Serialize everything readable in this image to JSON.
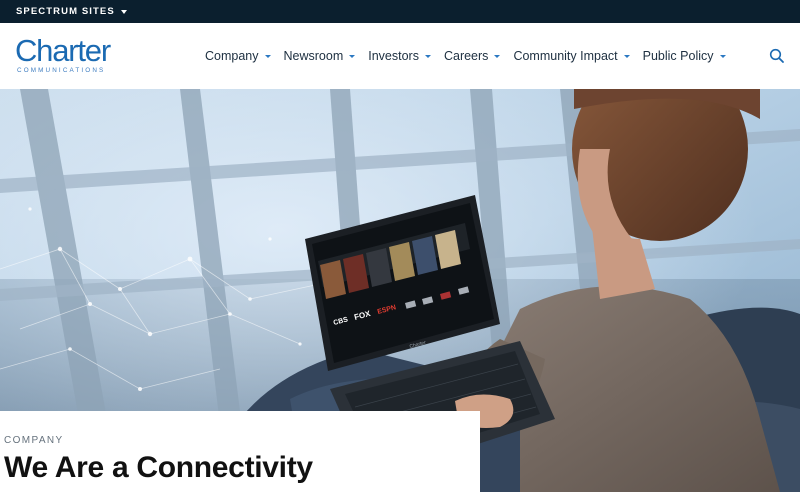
{
  "utility_bar": {
    "spectrum_sites_label": "SPECTRUM SITES"
  },
  "logo": {
    "wordmark": "Charter",
    "subtitle": "COMMUNICATIONS"
  },
  "nav": {
    "items": [
      {
        "label": "Company"
      },
      {
        "label": "Newsroom"
      },
      {
        "label": "Investors"
      },
      {
        "label": "Careers"
      },
      {
        "label": "Community Impact"
      },
      {
        "label": "Public Policy"
      }
    ]
  },
  "hero": {
    "laptop": {
      "screen_channels": [
        "CBS",
        "FOX",
        "ESPN"
      ],
      "brand": "Charter"
    }
  },
  "content": {
    "eyebrow": "COMPANY",
    "headline": "We Are a Connectivity"
  },
  "colors": {
    "utility_bar_bg": "#0b1f2e",
    "brand_blue": "#1b6ab2",
    "nav_text": "#1d2f40",
    "caret_blue": "#2b78c2"
  },
  "icons": {
    "utility_caret": "chevron-down-icon",
    "nav_caret": "chevron-down-icon",
    "search": "search-icon"
  }
}
